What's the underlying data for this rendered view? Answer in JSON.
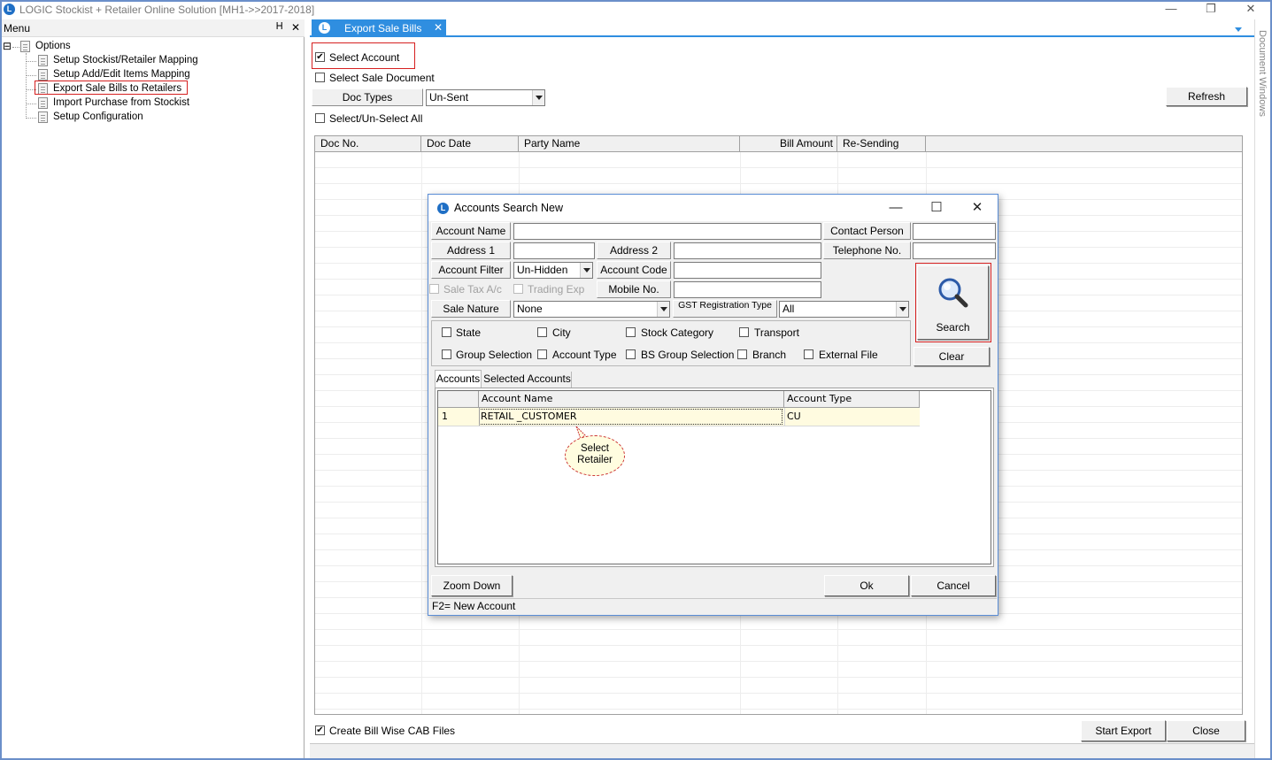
{
  "window": {
    "title": "LOGIC Stockist + Retailer Online Solution [MH1->>2017-2018]",
    "icon_letter": "L",
    "minimize": "—",
    "restore": "❐",
    "close": "✕"
  },
  "menu": {
    "header": "Menu",
    "pin": "Ꮋ",
    "close": "✕",
    "root_toggle": "⊟",
    "root_label": "Options",
    "items": [
      {
        "label": "Setup Stockist/Retailer Mapping"
      },
      {
        "label": "Setup Add/Edit Items Mapping"
      },
      {
        "label": "Export Sale Bills to Retailers"
      },
      {
        "label": "Import Purchase from Stockist"
      },
      {
        "label": "Setup Configuration"
      }
    ]
  },
  "tab": {
    "label": "Export Sale Bills",
    "close": "✕"
  },
  "document_windows_label": "Document Windows",
  "export_form": {
    "select_account": {
      "label": "Select Account",
      "checked": "✔"
    },
    "select_sale_document": {
      "label": "Select Sale Document"
    },
    "doc_types_label": "Doc Types",
    "doc_types_value": "Un-Sent",
    "refresh": "Refresh",
    "select_unselect_all": "Select/Un-Select All",
    "grid_columns": [
      "Doc No.",
      "Doc Date",
      "Party Name",
      "Bill Amount",
      "Re-Sending"
    ],
    "create_bill_wise": {
      "label": "Create Bill Wise CAB Files",
      "checked": "✔"
    },
    "start_export": "Start Export",
    "close": "Close"
  },
  "dialog": {
    "title": "Accounts Search New",
    "minimize": "—",
    "maximize": "☐",
    "close": "✕",
    "labels": {
      "account_name": "Account Name",
      "contact_person": "Contact Person",
      "address1": "Address 1",
      "address2": "Address 2",
      "telephone": "Telephone No.",
      "account_filter": "Account Filter",
      "account_code": "Account Code",
      "sale_tax": "Sale Tax A/c",
      "trading_exp": "Trading Exp",
      "mobile_no": "Mobile No.",
      "sale_nature": "Sale Nature",
      "gst_type": "GST Registration Type"
    },
    "account_filter_value": "Un-Hidden",
    "sale_nature_value": "None",
    "gst_type_value": "All",
    "filters_row1": [
      "State",
      "City",
      "Stock Category",
      "Transport"
    ],
    "filters_row2": [
      "Group Selection",
      "Account Type",
      "BS Group Selection",
      "Branch",
      "External File"
    ],
    "search": "Search",
    "clear": "Clear",
    "tabs": [
      "Accounts",
      "Selected Accounts"
    ],
    "grid_columns": [
      "Account Name",
      "Account Type"
    ],
    "rows": [
      {
        "num": "1",
        "name": "RETAIL _CUSTOMER",
        "type": "CU"
      }
    ],
    "callout": "Select Retailer",
    "zoom_down": "Zoom Down",
    "ok": "Ok",
    "cancel": "Cancel",
    "status": "F2= New Account"
  }
}
